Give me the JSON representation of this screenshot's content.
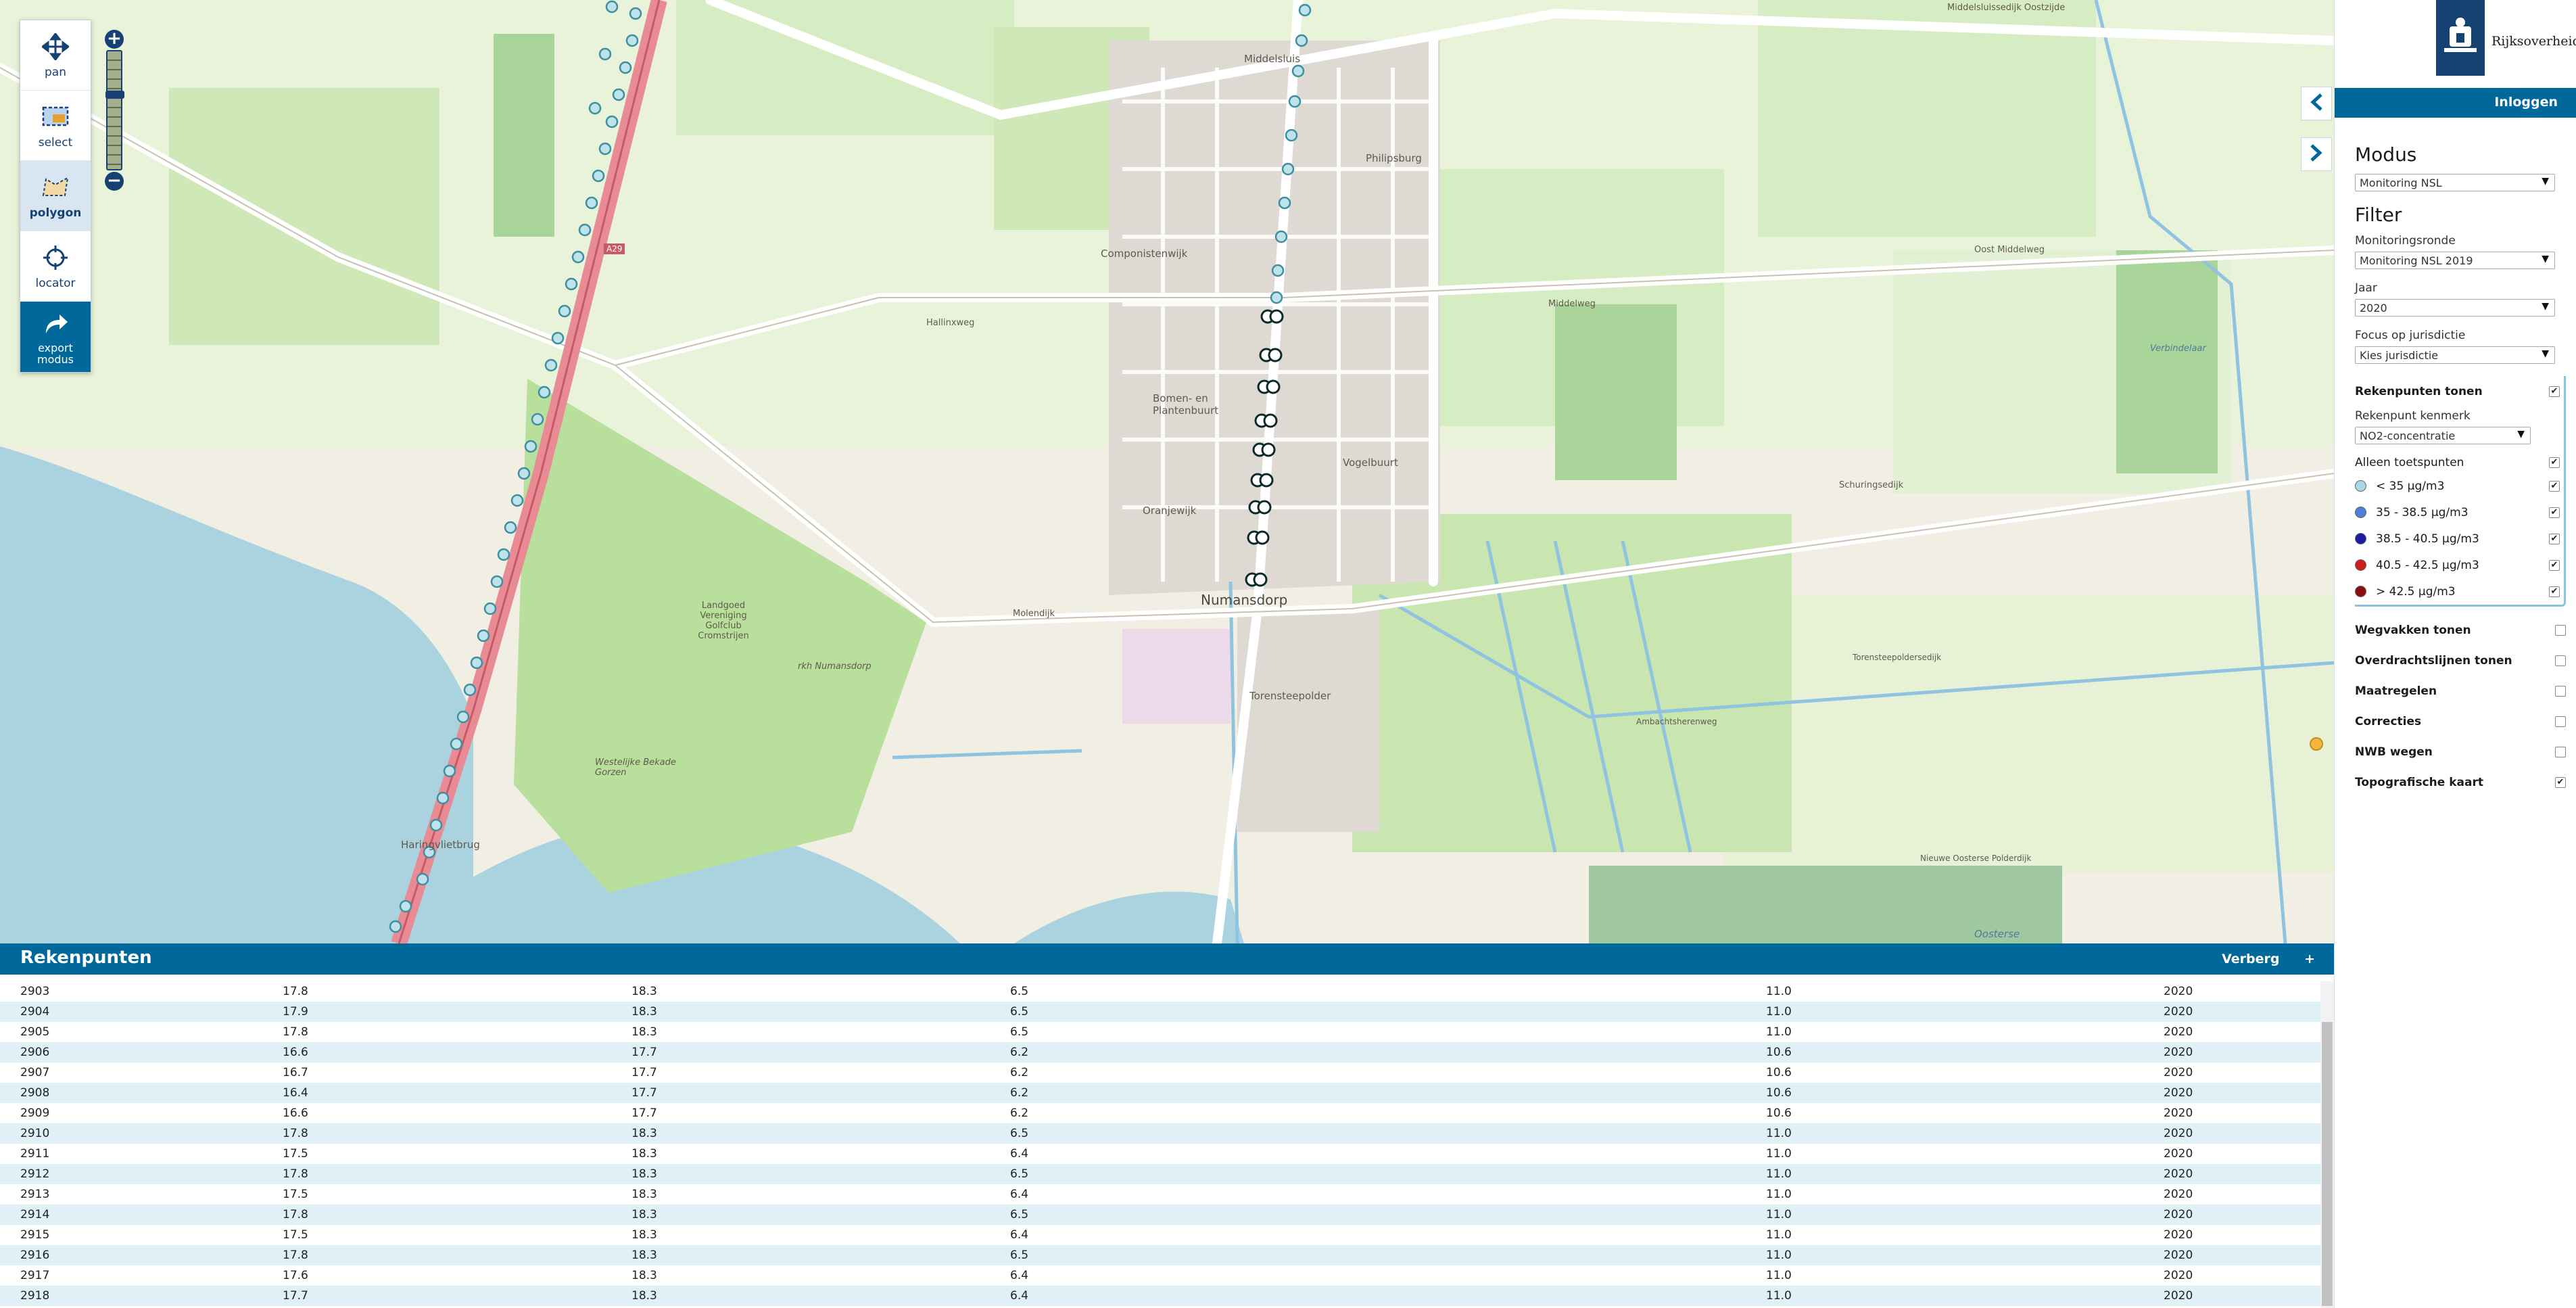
{
  "toolbar": {
    "items": [
      {
        "label": "pan",
        "icon": "move-icon"
      },
      {
        "label": "select",
        "icon": "select-rect-icon"
      },
      {
        "label": "polygon",
        "icon": "polygon-icon",
        "active": true
      },
      {
        "label": "locator",
        "icon": "crosshair-icon"
      },
      {
        "label": "export\nmodus",
        "icon": "share-arrow-icon"
      }
    ]
  },
  "zoom": {
    "plus": "+",
    "minus": "−"
  },
  "map": {
    "labels": {
      "numansdorp": "Numansdorp",
      "componistenwijk": "Componistenwijk",
      "bomen": "Bomen- en Plantenbuurt",
      "oranjewijk": "Oranjewijk",
      "vogelbuurt": "Vogelbuurt",
      "torensteepolder": "Torensteepolder",
      "philipsburg": "Philipsburg",
      "middelsluis": "Middelsluis",
      "haringvlietbrug": "Haringvlietbrug",
      "landgoed": "Landgoed Vereniging Golfclub Cromstrijen",
      "westelijke": "Westelijke Bekade Gorzen",
      "oostersé": "Oosterse",
      "verbindelaar": "Verbindelaar",
      "molendijk": "Molendijk",
      "middelweg": "Middelweg",
      "oostmiddelweg": "Oost Middelweg",
      "schuringsedijk": "Schuringsedijk",
      "hallinxweg": "Hallinxweg",
      "a29": "A29",
      "middelsluissedijk": "Middelsluissedijk Oostzijde",
      "torensteepoldersedijk": "Torensteepoldersedijk",
      "nieuweoosterse": "Nieuwe Oosterse Polderdijk",
      "rijknumansdorp": "rkh Numansdorp",
      "ambachtsherenweg": "Ambachtsherenweg"
    }
  },
  "panel": {
    "logo_text": "Rijksoverheid",
    "login": "Inloggen",
    "modus_title": "Modus",
    "modus_value": "Monitoring NSL",
    "filter_title": "Filter",
    "monitoringsronde_label": "Monitoringsronde",
    "monitoringsronde_value": "Monitoring NSL 2019",
    "jaar_label": "Jaar",
    "jaar_value": "2020",
    "focus_label": "Focus op jurisdictie",
    "focus_value": "Kies jurisdictie",
    "rekenpunten_tonen": "Rekenpunten tonen",
    "kenmerk_label": "Rekenpunt kenmerk",
    "kenmerk_value": "NO2-concentratie",
    "alleen_toetspunten": "Alleen toetspunten",
    "legend": [
      {
        "label": "< 35 µg/m3",
        "color": "#a8d8e6"
      },
      {
        "label": "35 - 38.5 µg/m3",
        "color": "#4f7fd6"
      },
      {
        "label": "38.5 - 40.5 µg/m3",
        "color": "#1b1ba6"
      },
      {
        "label": "40.5 - 42.5 µg/m3",
        "color": "#d01c1c"
      },
      {
        "label": "> 42.5 µg/m3",
        "color": "#8a0e0e"
      }
    ],
    "layers": [
      {
        "label": "Wegvakken tonen",
        "checked": false
      },
      {
        "label": "Overdrachtslijnen tonen",
        "checked": false
      },
      {
        "label": "Maatregelen",
        "checked": false
      },
      {
        "label": "Correcties",
        "checked": false
      },
      {
        "label": "NWB wegen",
        "checked": false
      },
      {
        "label": "Topografische kaart",
        "checked": true
      }
    ]
  },
  "table": {
    "title": "Rekenpunten",
    "hide": "Verberg",
    "plus": "+",
    "rows": [
      [
        "2903",
        "17.8",
        "18.3",
        "6.5",
        "11.0",
        "2020"
      ],
      [
        "2904",
        "17.9",
        "18.3",
        "6.5",
        "11.0",
        "2020"
      ],
      [
        "2905",
        "17.8",
        "18.3",
        "6.5",
        "11.0",
        "2020"
      ],
      [
        "2906",
        "16.6",
        "17.7",
        "6.2",
        "10.6",
        "2020"
      ],
      [
        "2907",
        "16.7",
        "17.7",
        "6.2",
        "10.6",
        "2020"
      ],
      [
        "2908",
        "16.4",
        "17.7",
        "6.2",
        "10.6",
        "2020"
      ],
      [
        "2909",
        "16.6",
        "17.7",
        "6.2",
        "10.6",
        "2020"
      ],
      [
        "2910",
        "17.8",
        "18.3",
        "6.5",
        "11.0",
        "2020"
      ],
      [
        "2911",
        "17.5",
        "18.3",
        "6.4",
        "11.0",
        "2020"
      ],
      [
        "2912",
        "17.8",
        "18.3",
        "6.5",
        "11.0",
        "2020"
      ],
      [
        "2913",
        "17.5",
        "18.3",
        "6.4",
        "11.0",
        "2020"
      ],
      [
        "2914",
        "17.8",
        "18.3",
        "6.5",
        "11.0",
        "2020"
      ],
      [
        "2915",
        "17.5",
        "18.3",
        "6.4",
        "11.0",
        "2020"
      ],
      [
        "2916",
        "17.8",
        "18.3",
        "6.5",
        "11.0",
        "2020"
      ],
      [
        "2917",
        "17.6",
        "18.3",
        "6.4",
        "11.0",
        "2020"
      ],
      [
        "2918",
        "17.7",
        "18.3",
        "6.4",
        "11.0",
        "2020"
      ]
    ]
  }
}
